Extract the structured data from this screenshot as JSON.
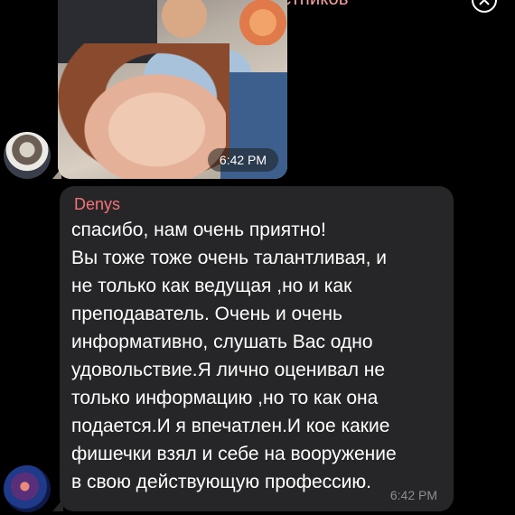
{
  "header": {
    "title": "Добавить участников"
  },
  "photo_message": {
    "time": "6:42 PM"
  },
  "text_message": {
    "sender": "Denys",
    "lines": [
      "спасибо, нам очень приятно!",
      "Вы тоже тоже очень талантливая, и",
      "не только как ведущая ,но и как",
      "преподаватель. Очень и очень",
      "информативно, слушать Вас одно",
      "удовольствие.Я лично оценивал не",
      "только информацию ,но то как она",
      "подается.И я впечатлен.И кое какие",
      "фишечки взял и себе на вооружение",
      "в свою действующую профессию."
    ],
    "time": "6:42 PM"
  },
  "colors": {
    "background": "#000000",
    "bubble": "#262628",
    "sender_name": "#f2737a",
    "header_accent": "#ffa0a0"
  },
  "icons": {
    "close": "close-circle-icon"
  }
}
